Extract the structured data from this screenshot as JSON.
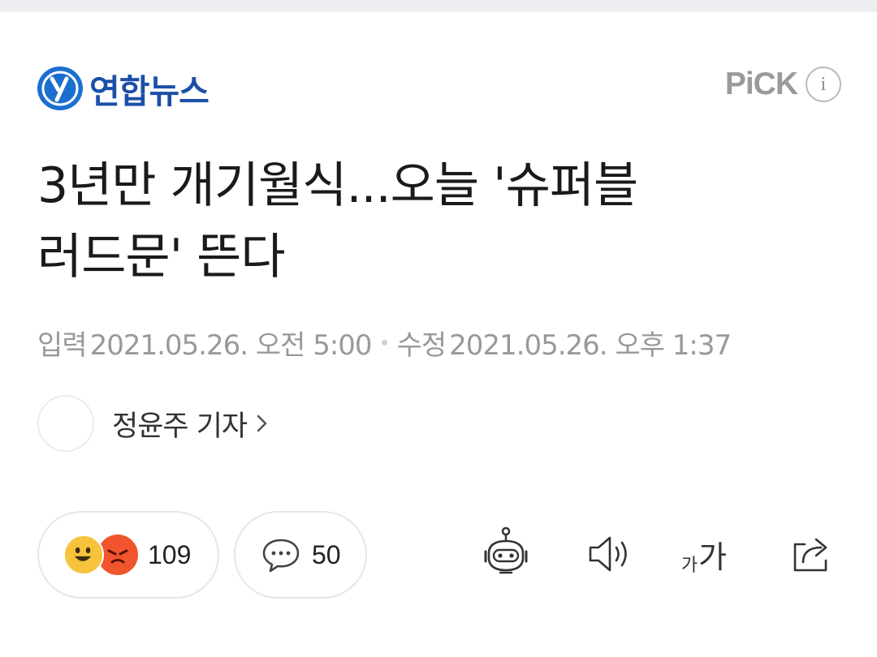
{
  "press": {
    "name": "연합뉴스",
    "emblem_glyph": "y",
    "brand_color": "#1b4fa8",
    "pick_label": "PiCK",
    "info_glyph": "i"
  },
  "article": {
    "headline_line1": "3년만 개기월식...오늘 '슈퍼블",
    "headline_line2": "러드문' 뜬다",
    "input_label": "입력",
    "input_datetime": "2021.05.26. 오전 5:00",
    "modified_label": "수정",
    "modified_datetime": "2021.05.26. 오후 1:37"
  },
  "author": {
    "name": "정윤주 기자"
  },
  "actions": {
    "reaction_count": "109",
    "comment_count": "50",
    "font_small_glyph": "가",
    "font_big_glyph": "가",
    "icons": [
      "happy-emoji-icon",
      "angry-emoji-icon",
      "speech-bubble-icon",
      "robot-summary-icon",
      "speaker-icon",
      "font-size-icon",
      "share-icon"
    ]
  },
  "colors": {
    "reaction_happy": "#f7c23c",
    "reaction_angry": "#f0552d",
    "meta_text": "#999999",
    "pick_text": "#9a9a9a"
  }
}
